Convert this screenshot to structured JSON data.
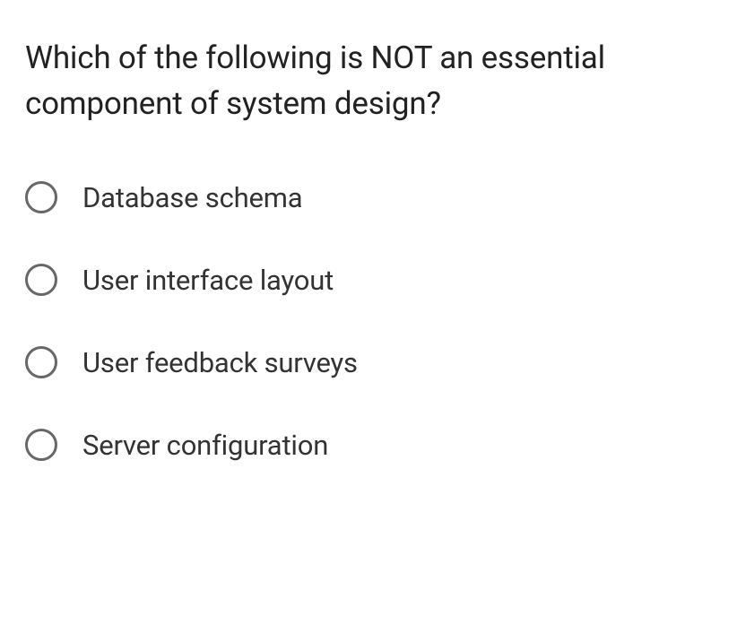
{
  "question": "Which of the following is NOT an essential component of system design?",
  "options": [
    {
      "label": "Database schema"
    },
    {
      "label": "User interface layout"
    },
    {
      "label": "User feedback surveys"
    },
    {
      "label": "Server configuration"
    }
  ]
}
